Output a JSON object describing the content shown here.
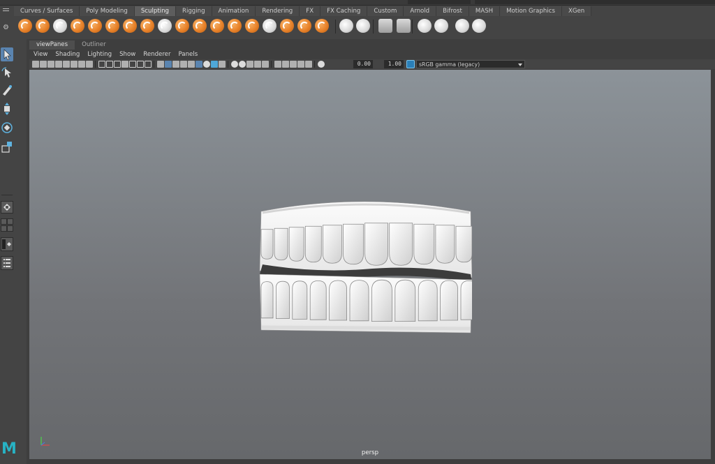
{
  "shelf": {
    "tabs": [
      {
        "label": "Curves / Surfaces",
        "active": false
      },
      {
        "label": "Poly Modeling",
        "active": false
      },
      {
        "label": "Sculpting",
        "active": true
      },
      {
        "label": "Rigging",
        "active": false
      },
      {
        "label": "Animation",
        "active": false
      },
      {
        "label": "Rendering",
        "active": false
      },
      {
        "label": "FX",
        "active": false
      },
      {
        "label": "FX Caching",
        "active": false
      },
      {
        "label": "Custom",
        "active": false
      },
      {
        "label": "Arnold",
        "active": false
      },
      {
        "label": "Bifrost",
        "active": false
      },
      {
        "label": "MASH",
        "active": false
      },
      {
        "label": "Motion Graphics",
        "active": false
      },
      {
        "label": "XGen",
        "active": false
      }
    ],
    "tools": [
      "sculpt-tool",
      "smooth-tool",
      "relax-tool",
      "grab-tool",
      "pinch-tool",
      "flatten-tool",
      "foamy-tool",
      "spray-tool",
      "repeat-tool",
      "imprint-tool",
      "wax-tool",
      "scrape-tool",
      "fill-tool",
      "knife-tool",
      "smear-tool",
      "bulge-tool",
      "amplify-tool",
      "freeze-tool"
    ],
    "extra_tools": [
      "convert-to-frozen",
      "mask-tool",
      "set-tool",
      "blend-shape",
      "sculpt-layer",
      "sculpt-options",
      "mesh-sculpt",
      "erase-sculpt"
    ]
  },
  "panel": {
    "tabs": [
      {
        "label": "viewPanes",
        "active": true
      },
      {
        "label": "Outliner",
        "active": false
      }
    ],
    "menu": [
      "View",
      "Shading",
      "Lighting",
      "Show",
      "Renderer",
      "Panels"
    ],
    "toolbar": {
      "exposure": "0.00",
      "gamma": "1.00",
      "color_space": "sRGB gamma (legacy)"
    }
  },
  "viewport": {
    "camera_label": "persp",
    "model": "teeth-model"
  },
  "colors": {
    "accent": "#5a84b0",
    "shelf_icon": "#e8822a",
    "maya_logo": "#27b2c4"
  },
  "logo": "M"
}
